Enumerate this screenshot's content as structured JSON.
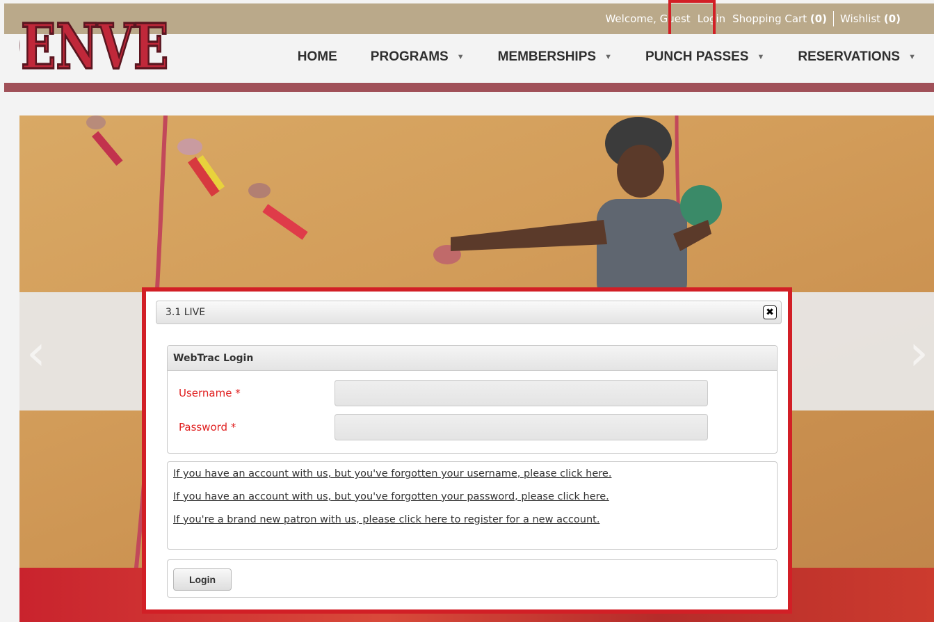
{
  "utility_bar": {
    "welcome": "Welcome, Guest",
    "login": "Login",
    "cart_label": "Shopping Cart",
    "cart_count": "(0)",
    "wishlist_label": "Wishlist",
    "wishlist_count": "(0)"
  },
  "logo": {
    "text": "DENVER"
  },
  "nav": {
    "items": [
      {
        "label": "HOME",
        "has_menu": false
      },
      {
        "label": "PROGRAMS",
        "has_menu": true
      },
      {
        "label": "MEMBERSHIPS",
        "has_menu": true
      },
      {
        "label": "PUNCH PASSES",
        "has_menu": true
      },
      {
        "label": "RESERVATIONS",
        "has_menu": true
      }
    ]
  },
  "modal": {
    "title": "3.1 LIVE",
    "panel_title": "WebTrac Login",
    "username_label": "Username *",
    "password_label": "Password *",
    "username_value": "",
    "password_value": "",
    "links": [
      "If you have an account with us, but you've forgotten your username, please click here.",
      "If you have an account with us, but you've forgotten your password, please click here.",
      "If you're a brand new patron with us, please click here to register for a new account."
    ],
    "login_button": "Login"
  },
  "colors": {
    "topbar": "#baa98a",
    "accent_red": "#d21f26",
    "logo_red": "#c0283a",
    "brand_band": "#a05058"
  }
}
